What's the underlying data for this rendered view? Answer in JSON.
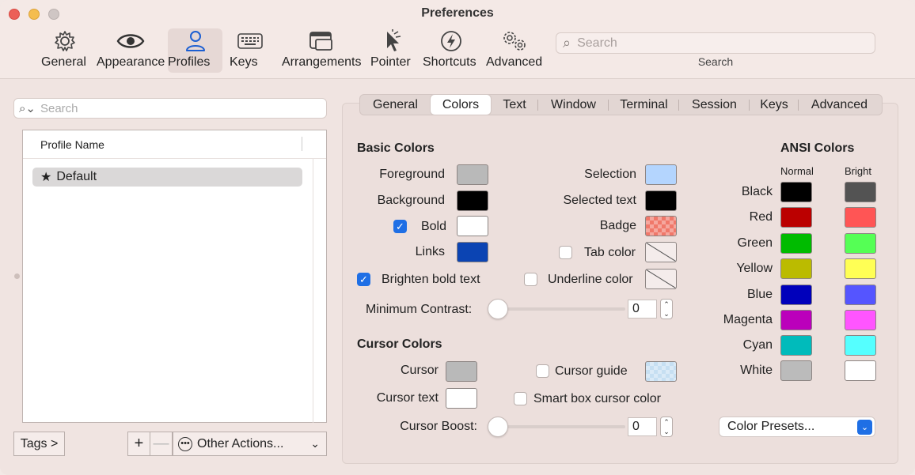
{
  "window": {
    "title": "Preferences"
  },
  "toolbar": {
    "items": [
      {
        "label": "General",
        "icon": "gear-icon"
      },
      {
        "label": "Appearance",
        "icon": "eye-icon"
      },
      {
        "label": "Profiles",
        "icon": "person-icon",
        "active": true
      },
      {
        "label": "Keys",
        "icon": "keyboard-icon"
      },
      {
        "label": "Arrangements",
        "icon": "windows-icon"
      },
      {
        "label": "Pointer",
        "icon": "pointer-icon"
      },
      {
        "label": "Shortcuts",
        "icon": "bolt-icon"
      },
      {
        "label": "Advanced",
        "icon": "gears-icon"
      }
    ],
    "search_placeholder": "Search",
    "search_label": "Search"
  },
  "profiles": {
    "search_placeholder": "Search",
    "column_header": "Profile Name",
    "rows": [
      {
        "name": "Default",
        "default": true
      }
    ],
    "tags_button": "Tags >",
    "add_symbol": "+",
    "remove_symbol": "—",
    "other_actions": "Other Actions..."
  },
  "tabs": [
    {
      "label": "General"
    },
    {
      "label": "Colors",
      "active": true
    },
    {
      "label": "Text"
    },
    {
      "label": "Window"
    },
    {
      "label": "Terminal"
    },
    {
      "label": "Session"
    },
    {
      "label": "Keys"
    },
    {
      "label": "Advanced"
    }
  ],
  "basic_colors": {
    "title": "Basic Colors",
    "foreground": {
      "label": "Foreground",
      "color": "#b9b9b9"
    },
    "background": {
      "label": "Background",
      "color": "#000000"
    },
    "bold": {
      "label": "Bold",
      "color": "#ffffff",
      "checked": true
    },
    "links": {
      "label": "Links",
      "color": "#0b44b3"
    },
    "selection": {
      "label": "Selection",
      "color": "#b4d5fe"
    },
    "selected_text": {
      "label": "Selected text",
      "color": "#000000"
    },
    "badge": {
      "label": "Badge",
      "color": "#f0786a"
    },
    "tab_color": {
      "label": "Tab color",
      "checked": false
    },
    "underline_color": {
      "label": "Underline color",
      "checked": false
    },
    "brighten_bold": {
      "label": "Brighten bold text",
      "checked": true
    },
    "min_contrast": {
      "label": "Minimum Contrast:",
      "value": "0",
      "level": 0
    }
  },
  "cursor_colors": {
    "title": "Cursor Colors",
    "cursor": {
      "label": "Cursor",
      "color": "#b9b9b9"
    },
    "cursor_text": {
      "label": "Cursor text",
      "color": "#ffffff"
    },
    "cursor_guide": {
      "label": "Cursor guide",
      "checked": false,
      "color": "#c6dff2"
    },
    "smart_box": {
      "label": "Smart box cursor color",
      "checked": false
    },
    "boost": {
      "label": "Cursor Boost:",
      "value": "0",
      "level": 0
    }
  },
  "ansi": {
    "title": "ANSI Colors",
    "normal_header": "Normal",
    "bright_header": "Bright",
    "rows": [
      {
        "name": "Black",
        "normal": "#000000",
        "bright": "#535353"
      },
      {
        "name": "Red",
        "normal": "#bb0000",
        "bright": "#ff5555"
      },
      {
        "name": "Green",
        "normal": "#00bb00",
        "bright": "#55ff55"
      },
      {
        "name": "Yellow",
        "normal": "#bbbb00",
        "bright": "#ffff55"
      },
      {
        "name": "Blue",
        "normal": "#0000bb",
        "bright": "#5555ff"
      },
      {
        "name": "Magenta",
        "normal": "#bb00bb",
        "bright": "#ff55ff"
      },
      {
        "name": "Cyan",
        "normal": "#00bbbb",
        "bright": "#55ffff"
      },
      {
        "name": "White",
        "normal": "#bbbbbb",
        "bright": "#ffffff"
      }
    ],
    "presets_label": "Color Presets..."
  },
  "colors": {
    "accent": "#1f6fe5"
  }
}
